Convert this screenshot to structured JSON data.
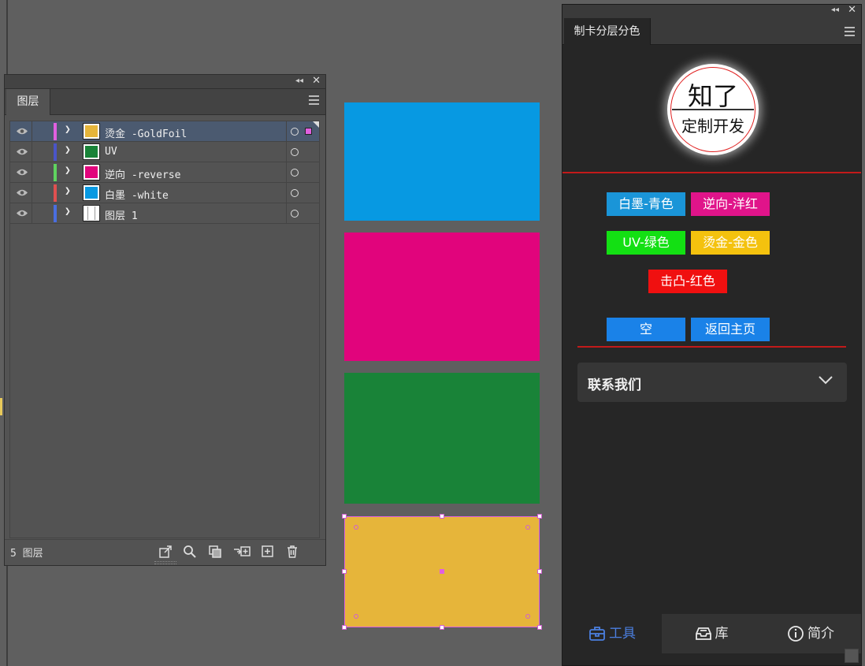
{
  "layers_panel": {
    "tab": "图层",
    "layers": [
      {
        "name": "烫金 -GoldFoil",
        "bar_color": "#e060e0",
        "thumb_color": "#e6b53a",
        "selected": true
      },
      {
        "name": "UV",
        "bar_color": "#4a55c8",
        "thumb_color": "#198338",
        "selected": false
      },
      {
        "name": "逆向 -reverse",
        "bar_color": "#5fd35f",
        "thumb_color": "#e1047c",
        "selected": false
      },
      {
        "name": "白墨 -white",
        "bar_color": "#e05050",
        "thumb_color": "#0799e2",
        "selected": false
      },
      {
        "name": "图层 1",
        "bar_color": "#4a6ee0",
        "thumb_color": "#ffffff",
        "selected": false
      }
    ],
    "footer_count": "5 图层",
    "footer_icons": [
      "export-icon",
      "search-icon",
      "clip-mask-icon",
      "new-sublayer-icon",
      "new-layer-icon",
      "trash-icon"
    ]
  },
  "artboard": {
    "colors": {
      "blue": "#0799e2",
      "pink": "#e1047c",
      "green": "#198338",
      "gold": "#e6b53a"
    }
  },
  "plugin": {
    "tab": "制卡分层分色",
    "logo_top": "知了",
    "logo_bottom": "定制开发",
    "buttons": {
      "white_cyan": "白墨-青色",
      "reverse_magenta": "逆向-洋红",
      "uv_green": "UV-绿色",
      "foil_gold": "烫金-金色",
      "emboss_red": "击凸-红色",
      "empty": "空",
      "home": "返回主页"
    },
    "button_colors": {
      "white_cyan": "#1a95d8",
      "reverse_magenta": "#e0148a",
      "uv_green": "#13e013",
      "foil_gold": "#f4c20e",
      "emboss_red": "#f01010",
      "empty": "#1a82e8",
      "home": "#1a82e8"
    },
    "contact": "联系我们",
    "nav": {
      "tools": "工具",
      "library": "库",
      "about": "简介"
    }
  }
}
